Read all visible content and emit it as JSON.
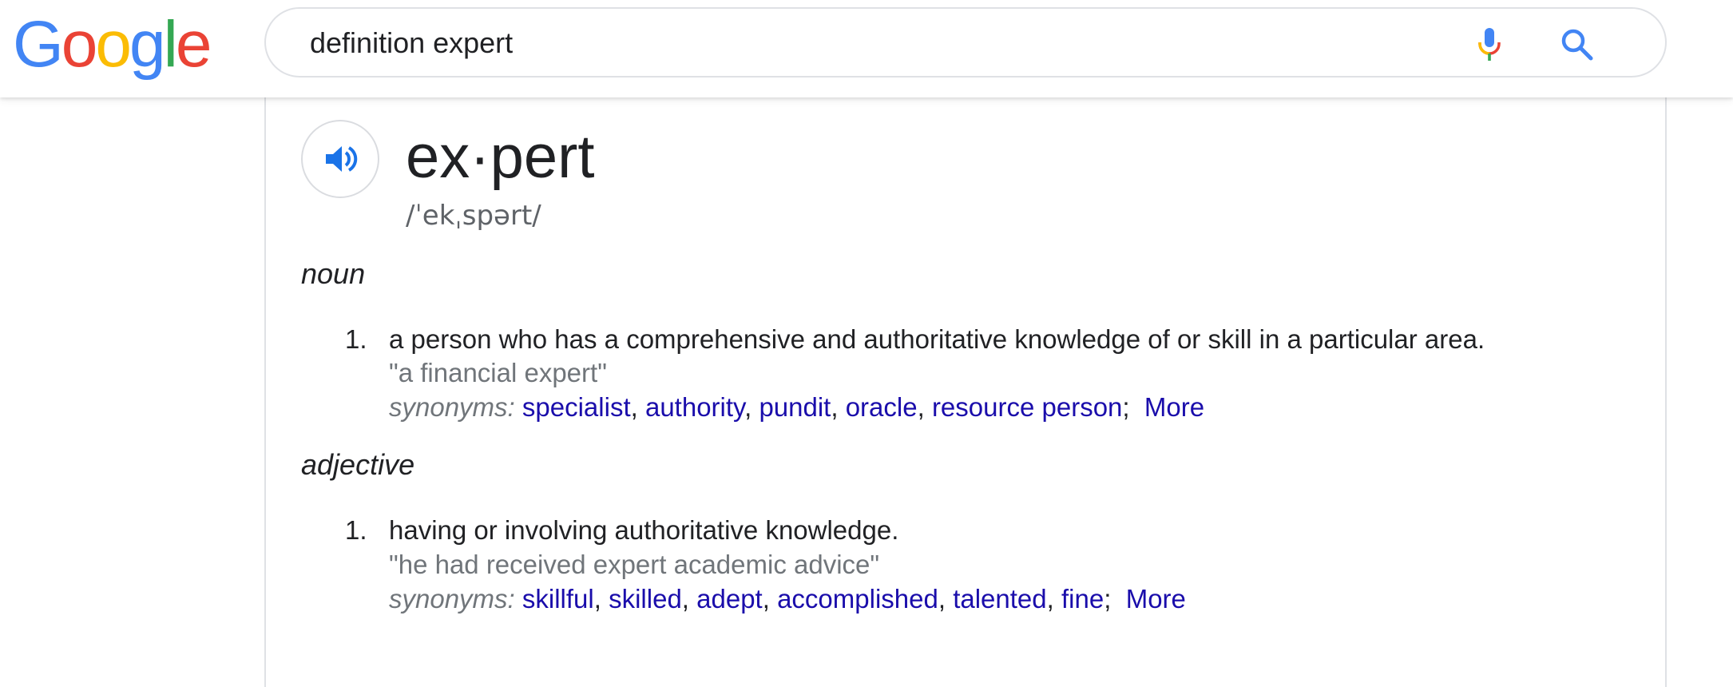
{
  "logo": {
    "letters": [
      "G",
      "o",
      "o",
      "g",
      "l",
      "e"
    ],
    "colors": [
      "#4285F4",
      "#EA4335",
      "#FBBC05",
      "#4285F4",
      "#34A853",
      "#EA4335"
    ]
  },
  "search": {
    "query": "definition expert",
    "mic_icon": "microphone-icon",
    "search_icon": "magnifier-icon"
  },
  "entry": {
    "headword": "ex·pert",
    "phonetic": "/ˈekˌspərt/",
    "speaker_icon": "speaker-icon",
    "senses": [
      {
        "pos": "noun",
        "definitions": [
          {
            "number": "1.",
            "text": "a person who has a comprehensive and authoritative knowledge of or skill in a particular area.",
            "example": "\"a financial expert\"",
            "synonyms_label": "synonyms:",
            "synonyms": [
              "specialist",
              "authority",
              "pundit",
              "oracle",
              "resource person"
            ],
            "more": "More"
          }
        ]
      },
      {
        "pos": "adjective",
        "definitions": [
          {
            "number": "1.",
            "text": "having or involving authoritative knowledge.",
            "example": "\"he had received expert academic advice\"",
            "synonyms_label": "synonyms:",
            "synonyms": [
              "skillful",
              "skilled",
              "adept",
              "accomplished",
              "talented",
              "fine"
            ],
            "more": "More"
          }
        ]
      }
    ]
  },
  "colors": {
    "link": "#1a0dab",
    "muted": "#70757a",
    "speaker_blue": "#1a73e8",
    "border": "#dfe1e5"
  }
}
